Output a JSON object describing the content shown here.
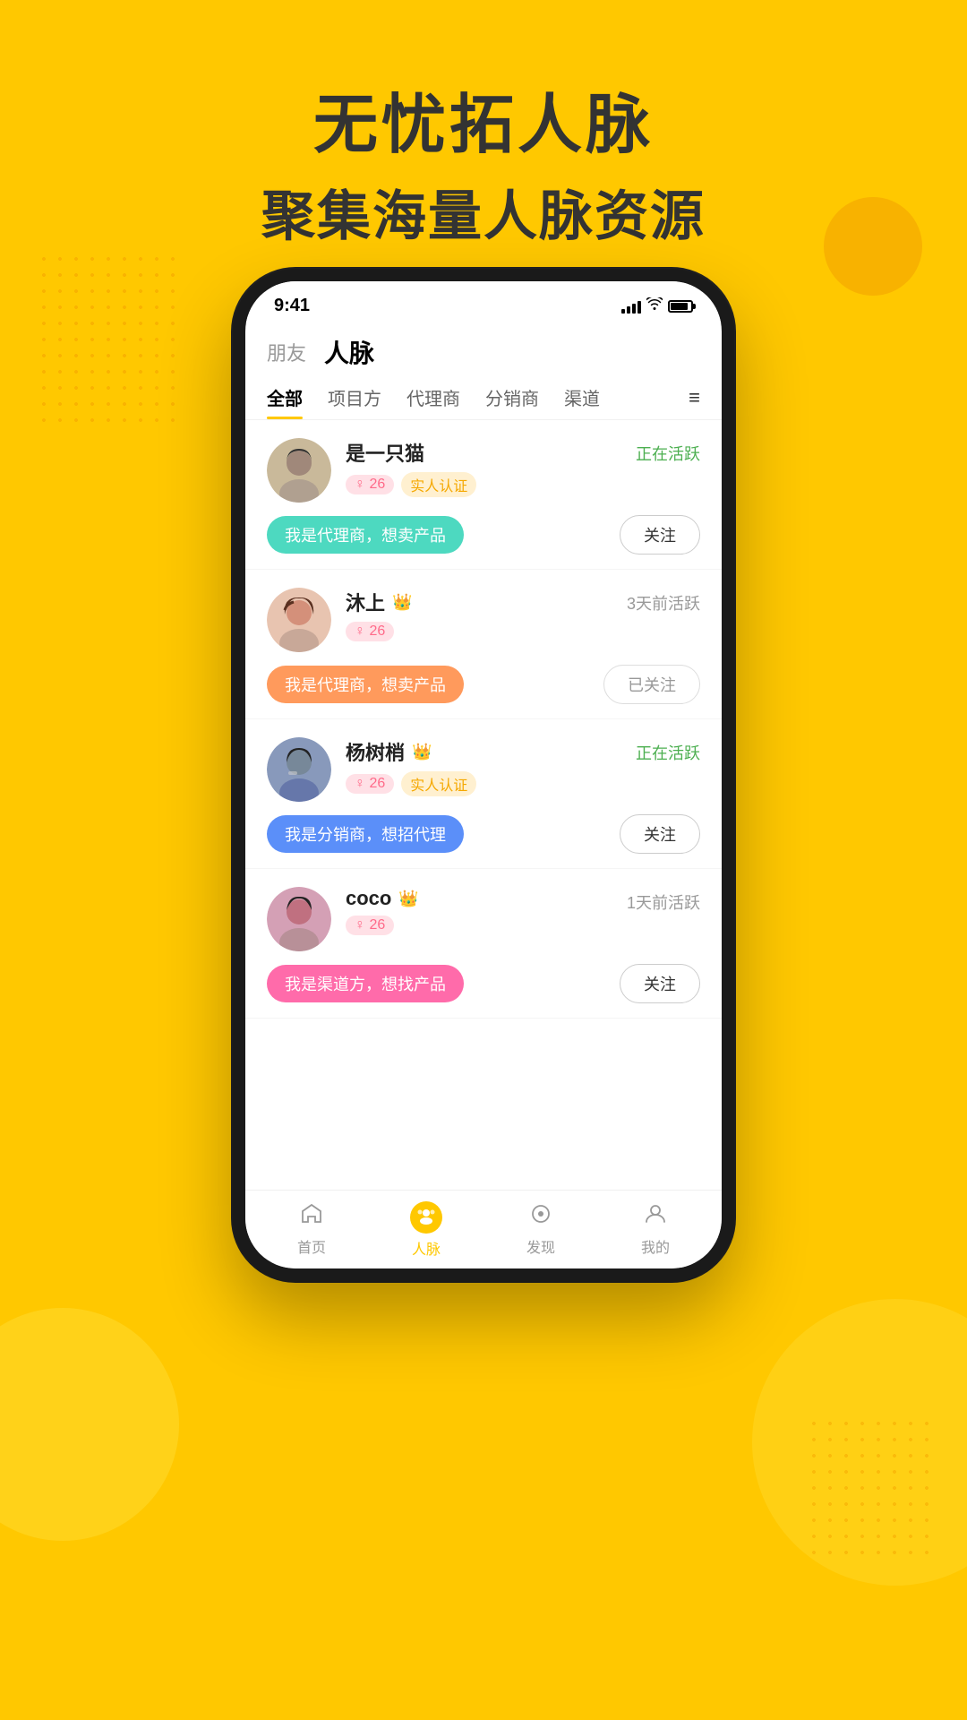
{
  "background_color": "#FFC800",
  "header": {
    "line1": "无忧拓人脉",
    "line2": "聚集海量人脉资源"
  },
  "phone": {
    "status_bar": {
      "time": "9:41"
    },
    "top_nav": {
      "friends_label": "朋友",
      "renmai_label": "人脉"
    },
    "filter_tabs": [
      {
        "label": "全部",
        "active": true
      },
      {
        "label": "项目方",
        "active": false
      },
      {
        "label": "代理商",
        "active": false
      },
      {
        "label": "分销商",
        "active": false
      },
      {
        "label": "渠道",
        "active": false
      }
    ],
    "users": [
      {
        "name": "是一只猫",
        "gender": "♀26",
        "verified": true,
        "verified_label": "实人认证",
        "status": "正在活跃",
        "status_active": true,
        "intro": "我是代理商，想卖产品",
        "intro_color": "teal",
        "follow_label": "关注",
        "followed": false,
        "crown": false,
        "avatar_color": "#c9b99a"
      },
      {
        "name": "沐上",
        "gender": "♀26",
        "verified": false,
        "verified_label": "",
        "status": "3天前活跃",
        "status_active": false,
        "intro": "我是代理商，想卖产品",
        "intro_color": "orange",
        "follow_label": "已关注",
        "followed": true,
        "crown": true,
        "avatar_color": "#e8b4a0"
      },
      {
        "name": "杨树梢",
        "gender": "♀26",
        "verified": true,
        "verified_label": "实人认证",
        "status": "正在活跃",
        "status_active": true,
        "intro": "我是分销商，想招代理",
        "intro_color": "blue",
        "follow_label": "关注",
        "followed": false,
        "crown": true,
        "avatar_color": "#8899aa"
      },
      {
        "name": "coco",
        "gender": "♀26",
        "verified": false,
        "verified_label": "",
        "status": "1天前活跃",
        "status_active": false,
        "intro": "我是渠道方，想找产品",
        "intro_color": "pink",
        "follow_label": "关注",
        "followed": false,
        "crown": true,
        "avatar_color": "#d4a0b0"
      }
    ],
    "bottom_nav": [
      {
        "label": "首页",
        "icon": "🔔",
        "active": false
      },
      {
        "label": "人脉",
        "icon": "😊",
        "active": true
      },
      {
        "label": "发现",
        "icon": "⊙",
        "active": false
      },
      {
        "label": "我的",
        "icon": "👤",
        "active": false
      }
    ]
  }
}
